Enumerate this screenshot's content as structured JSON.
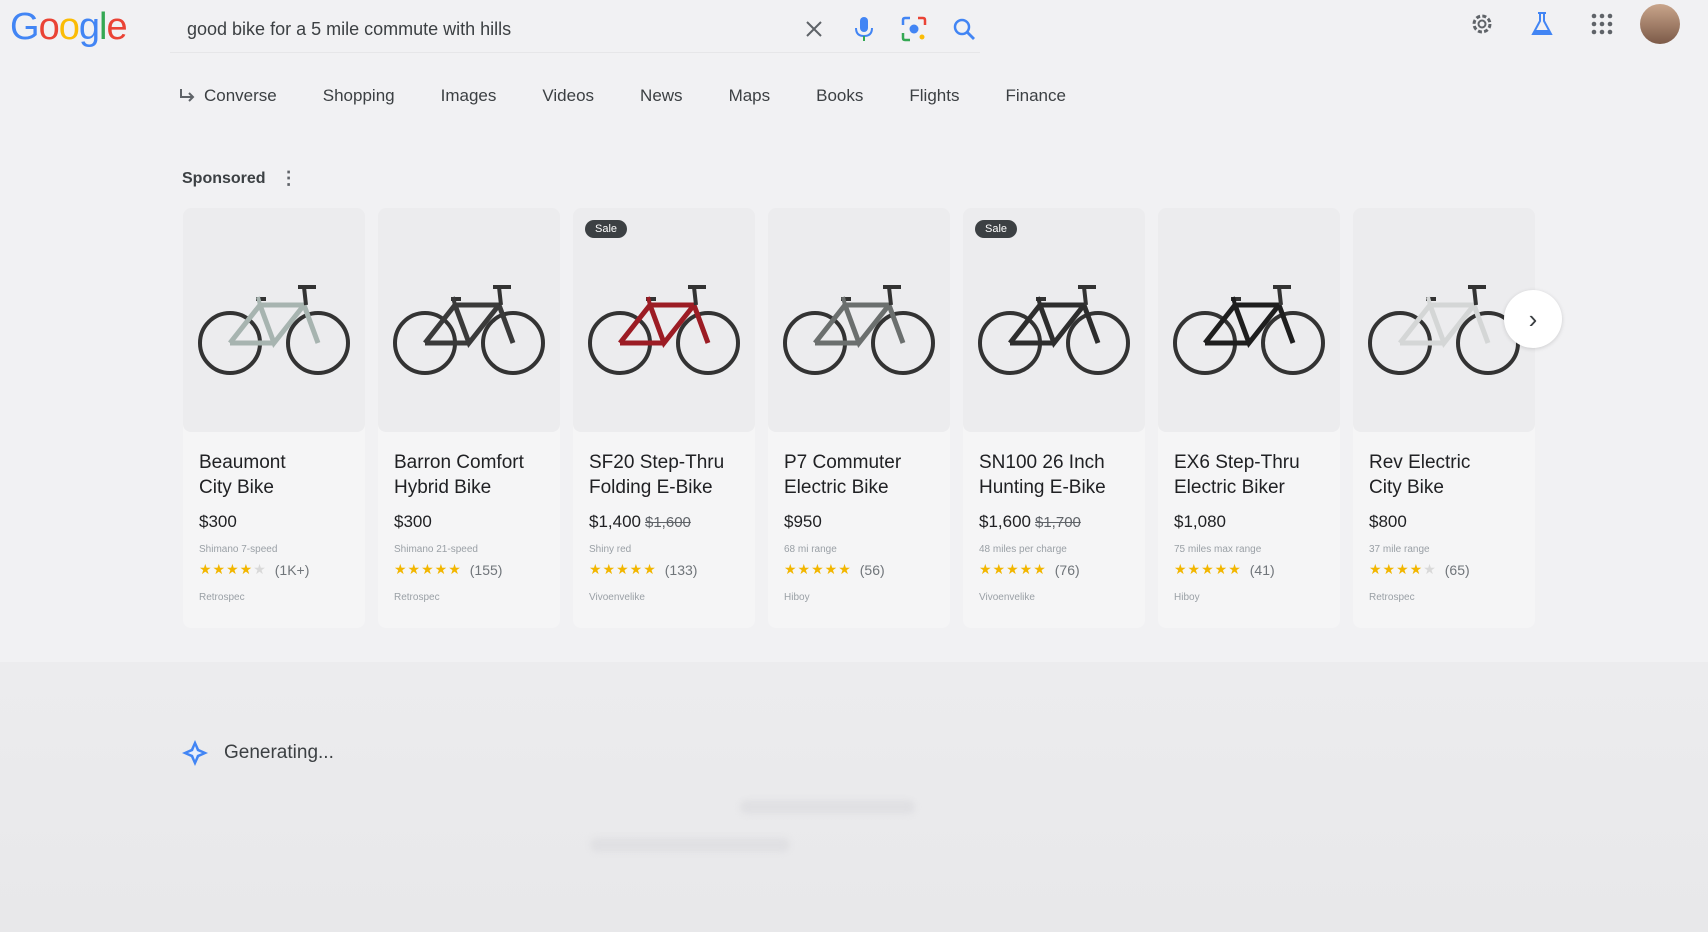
{
  "logo": {
    "letters": [
      "G",
      "o",
      "o",
      "g",
      "l",
      "e"
    ],
    "colors": [
      "#4285F4",
      "#EA4335",
      "#FBBC05",
      "#4285F4",
      "#34A853",
      "#EA4335"
    ]
  },
  "search": {
    "query": "good bike for a 5 mile commute with hills"
  },
  "header_icons": [
    "clear-icon",
    "mic-icon",
    "lens-icon",
    "search-icon",
    "gear-icon",
    "labs-flask-icon",
    "apps-grid-icon"
  ],
  "tabs": [
    {
      "label": "Converse"
    },
    {
      "label": "Shopping"
    },
    {
      "label": "Images"
    },
    {
      "label": "Videos"
    },
    {
      "label": "News"
    },
    {
      "label": "Maps"
    },
    {
      "label": "Books"
    },
    {
      "label": "Flights"
    },
    {
      "label": "Finance"
    }
  ],
  "sponsored": {
    "label": "Sponsored",
    "menu_glyph": "⋮"
  },
  "products": [
    {
      "name_line1": "Beaumont",
      "name_line2": "City Bike",
      "price": "$300",
      "old_price": "",
      "sale": false,
      "detail": "Shimano 7-speed",
      "stars": 4,
      "reviews": "(1K+)",
      "seller": "Retrospec",
      "frame_color": "#a7b4b0"
    },
    {
      "name_line1": "Barron Comfort",
      "name_line2": "Hybrid Bike",
      "price": "$300",
      "old_price": "",
      "sale": false,
      "detail": "Shimano 21-speed",
      "stars": 4.5,
      "reviews": "(155)",
      "seller": "Retrospec",
      "frame_color": "#3a3a3a"
    },
    {
      "name_line1": "SF20 Step-Thru",
      "name_line2": "Folding E-Bike",
      "price": "$1,400",
      "old_price": "$1,600",
      "sale": true,
      "sale_label": "Sale",
      "detail": "Shiny red",
      "stars": 5,
      "reviews": "(133)",
      "seller": "Vivoenvelike",
      "frame_color": "#9c1c24"
    },
    {
      "name_line1": "P7 Commuter",
      "name_line2": "Electric Bike",
      "price": "$950",
      "old_price": "",
      "sale": false,
      "detail": "68 mi range",
      "stars": 5,
      "reviews": "(56)",
      "seller": "Hiboy",
      "frame_color": "#6b6f6e"
    },
    {
      "name_line1": "SN100 26 Inch",
      "name_line2": "Hunting E-Bike",
      "price": "$1,600",
      "old_price": "$1,700",
      "sale": true,
      "sale_label": "Sale",
      "detail": "48 miles per charge",
      "stars": 5,
      "reviews": "(76)",
      "seller": "Vivoenvelike",
      "frame_color": "#2d2d2d"
    },
    {
      "name_line1": "EX6 Step-Thru",
      "name_line2": "Electric Biker",
      "price": "$1,080",
      "old_price": "",
      "sale": false,
      "detail": "75 miles max range",
      "stars": 5,
      "reviews": "(41)",
      "seller": "Hiboy",
      "frame_color": "#1e1e1e"
    },
    {
      "name_line1": "Rev Electric",
      "name_line2": "City Bike",
      "price": "$800",
      "old_price": "",
      "sale": false,
      "detail": "37 mile range",
      "stars": 3.5,
      "reviews": "(65)",
      "seller": "Retrospec",
      "frame_color": "#d4d6d6"
    }
  ],
  "carousel": {
    "next_glyph": "›"
  },
  "status": {
    "generating": "Generating..."
  }
}
